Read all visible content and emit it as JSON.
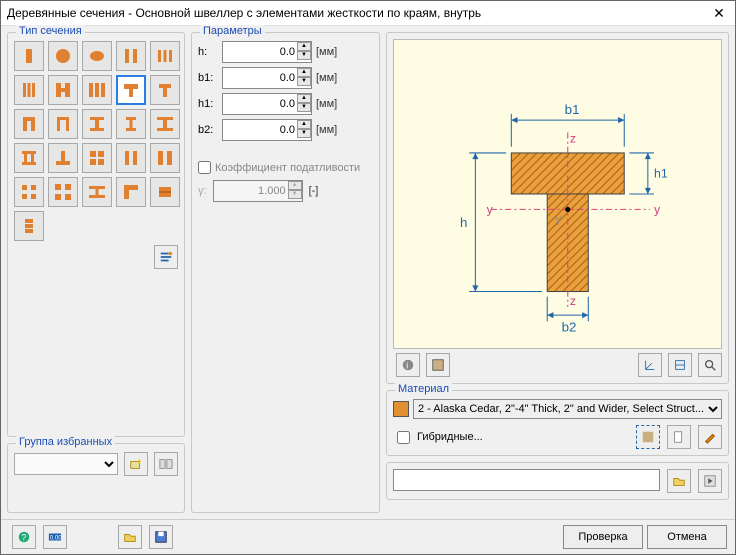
{
  "title": "Деревянные сечения - Основной швеллер с элементами жесткости по краям, внутрь",
  "sections": {
    "type": "Тип сечения",
    "favorites": "Группа избранных",
    "params": "Параметры",
    "material": "Материал"
  },
  "icons": [
    "rect",
    "circle",
    "ellipse",
    "double-rect",
    "triple-i",
    "triple-bars",
    "double-i",
    "triple-plates",
    "tee-1",
    "tee-2",
    "channel",
    "channel-2",
    "i-flange",
    "i-narrow",
    "i-wide",
    "i-plates",
    "tee-low",
    "grid",
    "two-col",
    "two-plank",
    "four-sq",
    "four-sq-b",
    "i-beam",
    "angle",
    "brick",
    "stack"
  ],
  "selected_icon_index": 8,
  "params": {
    "labels": {
      "h": "h:",
      "b1": "b1:",
      "h1": "h1:",
      "b2": "b2:"
    },
    "values": {
      "h": "0.0",
      "b1": "0.0",
      "h1": "0.0",
      "b2": "0.0"
    },
    "unit": "[мм]",
    "gamma_label": "γ:",
    "gamma_value": "1.000",
    "gamma_unit": "[-]",
    "flex_checkbox": "Коэффициент податливости"
  },
  "preview_labels": {
    "b1": "b1",
    "b2": "b2",
    "h": "h",
    "h1": "h1",
    "y": "y",
    "z": "z",
    "gamma": "γ"
  },
  "material": {
    "selected": "2 - Alaska Cedar, 2\"-4\" Thick, 2\" and Wider, Select Struct...",
    "hybrid": "Гибридные..."
  },
  "footer": {
    "check": "Проверка",
    "cancel": "Отмена"
  }
}
